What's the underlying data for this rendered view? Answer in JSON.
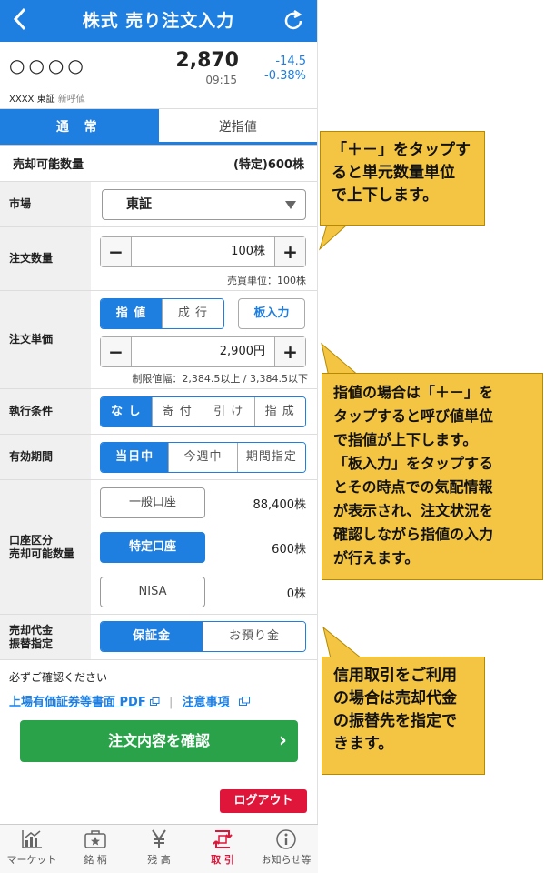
{
  "header": {
    "back_icon": "back-arrow-icon",
    "title": "株式 売り注文入力",
    "refresh_icon": "refresh-icon"
  },
  "quote": {
    "name": "○○○○",
    "price": "2,870",
    "time": "09:15",
    "change": "-14.5",
    "change_pct": "-0.38%",
    "code": "XXXX",
    "market": "東証",
    "flag": "新呼値",
    "change_color": "#1e7fe0"
  },
  "tabs": [
    {
      "label": "通 常",
      "active": true
    },
    {
      "label": "逆指値",
      "active": false
    }
  ],
  "available": {
    "label": "売却可能数量",
    "value": "(特定)600株"
  },
  "market": {
    "label": "市場",
    "value": "東証"
  },
  "quantity": {
    "label": "注文数量",
    "minus": "−",
    "value": "100株",
    "plus": "+",
    "unit_note": "売買単位：100株"
  },
  "price": {
    "label": "注文単価",
    "type_options": [
      "指 値",
      "成 行"
    ],
    "board_button": "板入力",
    "minus": "−",
    "value": "2,900円",
    "plus": "+",
    "limit_note": "制限値幅：2,384.5以上 / 3,384.5以下"
  },
  "condition": {
    "label": "執行条件",
    "options": [
      "な し",
      "寄 付",
      "引 け",
      "指 成"
    ]
  },
  "period": {
    "label": "有効期間",
    "options": [
      "当日中",
      "今週中",
      "期間指定"
    ]
  },
  "account": {
    "label_line1": "口座区分",
    "label_line2": "売却可能数量",
    "items": [
      {
        "label": "一般口座",
        "qty": "88,400株",
        "selected": false
      },
      {
        "label": "特定口座",
        "qty": "600株",
        "selected": true
      },
      {
        "label": "NISA",
        "qty": "0株",
        "selected": false
      }
    ]
  },
  "transfer": {
    "label_line1": "売却代金",
    "label_line2": "振替指定",
    "options": [
      "保証金",
      "お預り金"
    ]
  },
  "confirm": {
    "notice": "必ずご確認ください",
    "link1": "上場有価証券等書面 PDF",
    "link2": "注意事項"
  },
  "cta": {
    "label": "注文内容を確認",
    "arrow": "›"
  },
  "logout": "ログアウト",
  "tabbar": [
    {
      "label": "マーケット",
      "icon": "chart-icon",
      "active": false
    },
    {
      "label": "銘 柄",
      "icon": "briefcase-star-icon",
      "active": false
    },
    {
      "label": "残 高",
      "icon": "yen-icon",
      "active": false
    },
    {
      "label": "取 引",
      "icon": "exchange-icon",
      "active": true
    },
    {
      "label": "お知らせ等",
      "icon": "info-icon",
      "active": false
    }
  ],
  "callouts": [
    {
      "lines": [
        "「＋－」をタップす",
        "ると単元数量単位",
        "で上下します。"
      ]
    },
    {
      "lines": [
        "指値の場合は「＋－」を",
        "タップすると呼び値単位",
        "で指値が上下します。",
        "「板入力」をタップする",
        "とその時点での気配情報",
        "が表示され、注文状況を",
        "確認しながら指値の入力",
        "が行えます。"
      ]
    },
    {
      "lines": [
        "信用取引をご利用",
        "の場合は売却代金",
        "の振替先を指定で",
        "きます。"
      ]
    }
  ],
  "colors": {
    "primary": "#1e7fe0",
    "cta": "#2aa24a",
    "logout": "#e0153a",
    "callout": "#f4c542"
  }
}
